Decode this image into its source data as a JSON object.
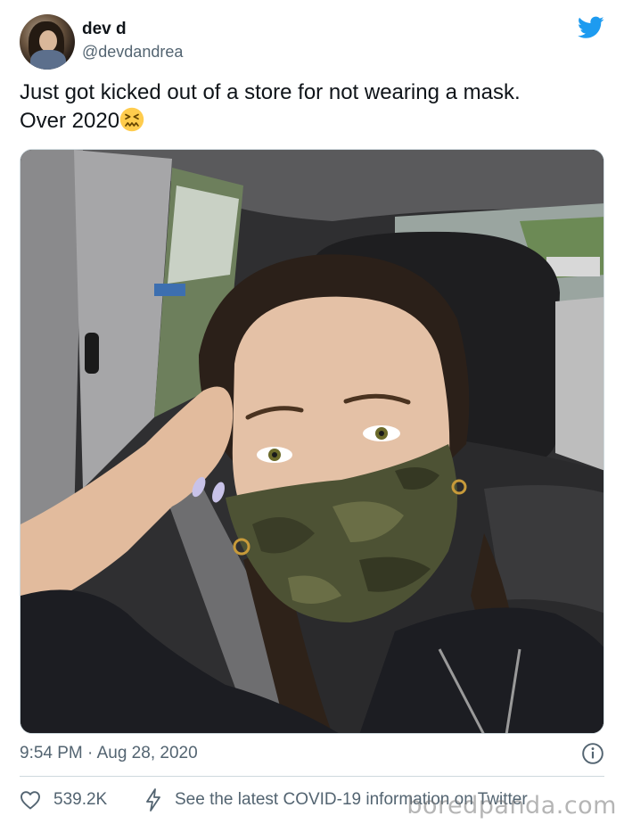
{
  "tweet": {
    "author": {
      "display_name": "dev d",
      "handle": "@devdandrea",
      "avatar": "profile-photo"
    },
    "text_line1": "Just got kicked out of a store for not wearing a mask.",
    "text_line2": "Over 2020",
    "emoji": "confounded-face-emoji",
    "media": {
      "type": "photo",
      "description_icon": "selfie-in-car-with-camo-mask"
    },
    "timestamp": "9:54 PM · Aug 28, 2020",
    "likes": "539.2K",
    "covid_link": "See the latest COVID-19 information on Twitter",
    "colors": {
      "twitter_blue": "#1d9bf0",
      "text_primary": "#0f1419",
      "text_secondary": "#536471",
      "border": "#cfd9de"
    }
  },
  "watermark": "boredpanda.com"
}
